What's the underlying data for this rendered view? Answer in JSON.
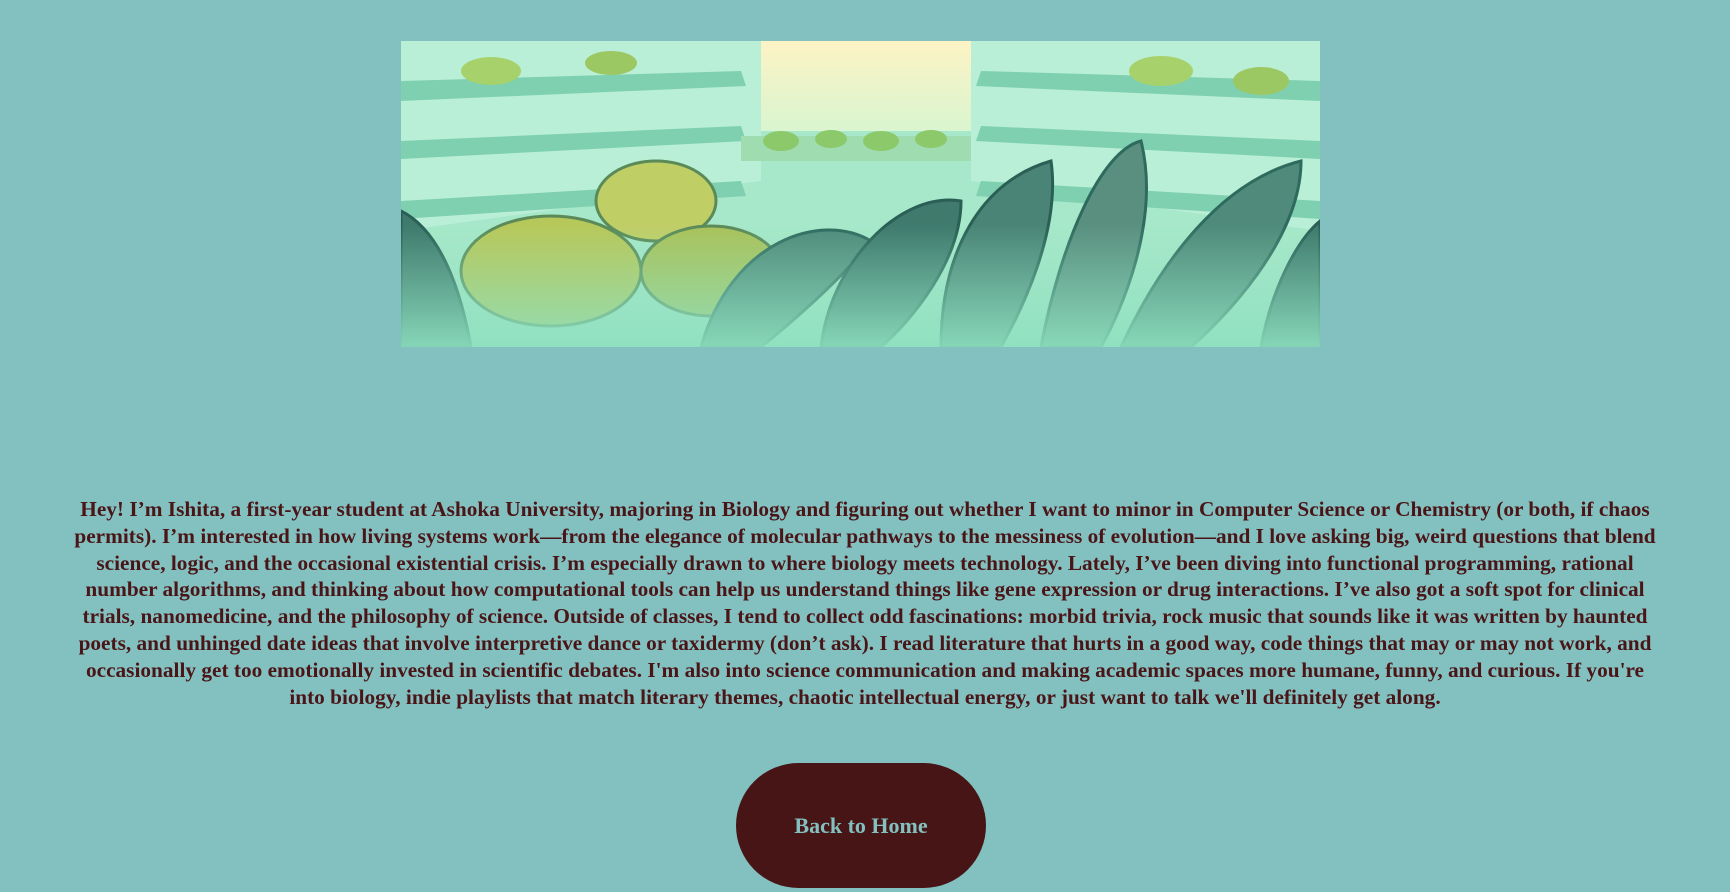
{
  "colors": {
    "page_background": "#83c1c1",
    "text": "#4a1517",
    "button_background": "#481516",
    "button_text": "#83c1c1"
  },
  "banner": {
    "icon": "greenhouse-plants-illustration"
  },
  "bio": {
    "text": "Hey! I’m Ishita, a first-year student at Ashoka University, majoring in Biology and figuring out whether I want to minor in Computer Science or Chemistry (or both, if chaos permits). I’m interested in how living systems work—from the elegance of molecular pathways to the messiness of evolution—and I love asking big, weird questions that blend science, logic, and the occasional existential crisis. I’m especially drawn to where biology meets technology. Lately, I’ve been diving into functional programming, rational number algorithms, and thinking about how computational tools can help us understand things like gene expression or drug interactions. I’ve also got a soft spot for clinical trials, nanomedicine, and the philosophy of science. Outside of classes, I tend to collect odd fascinations: morbid trivia, rock music that sounds like it was written by haunted poets, and unhinged date ideas that involve interpretive dance or taxidermy (don’t ask). I read literature that hurts in a good way, code things that may or may not work, and occasionally get too emotionally invested in scientific debates. I'm also into science communication and making academic spaces more humane, funny, and curious. If you're into biology, indie playlists that match literary themes, chaotic intellectual energy, or just want to talk we'll definitely get along."
  },
  "nav": {
    "back_home_label": "Back to Home"
  }
}
